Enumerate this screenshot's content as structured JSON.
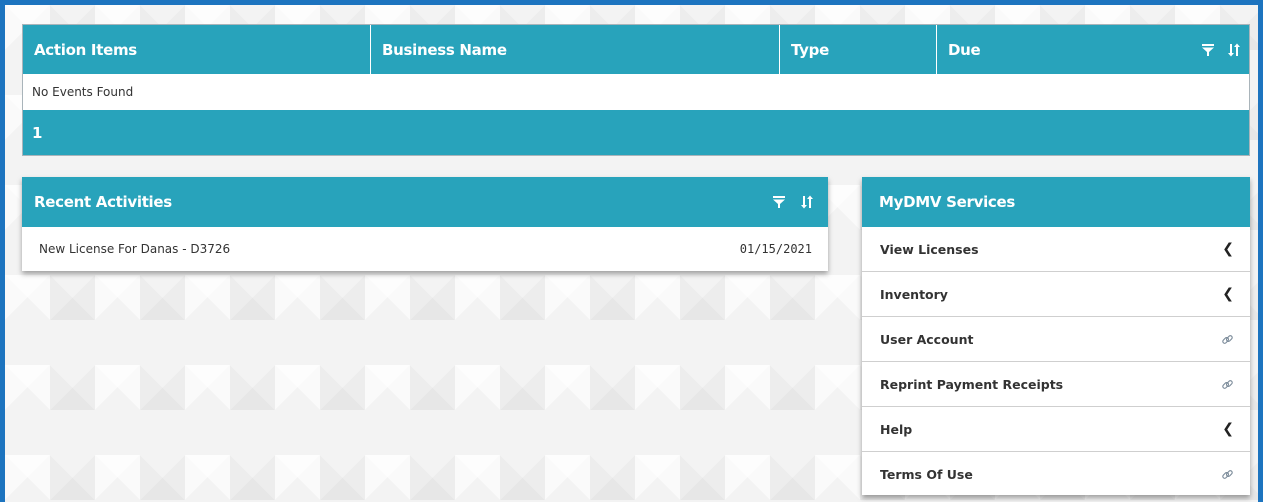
{
  "action_items": {
    "columns": [
      "Action Items",
      "Business Name",
      "Type",
      "Due"
    ],
    "empty_message": "No Events Found",
    "page": "1"
  },
  "recent_activities": {
    "title": "Recent Activities",
    "items": [
      {
        "text": "New License For Danas - D3726",
        "date": "01/15/2021"
      }
    ]
  },
  "services": {
    "title": "MyDMV Services",
    "items": [
      {
        "label": "View Licenses",
        "icon": "chevron-left-icon"
      },
      {
        "label": "Inventory",
        "icon": "chevron-left-icon"
      },
      {
        "label": "User Account",
        "icon": "link-icon"
      },
      {
        "label": "Reprint Payment Receipts",
        "icon": "link-icon"
      },
      {
        "label": "Help",
        "icon": "chevron-left-icon"
      },
      {
        "label": "Terms Of Use",
        "icon": "link-icon"
      }
    ]
  },
  "colors": {
    "header_teal": "#28a3bb",
    "frame_blue": "#1d74bf"
  }
}
